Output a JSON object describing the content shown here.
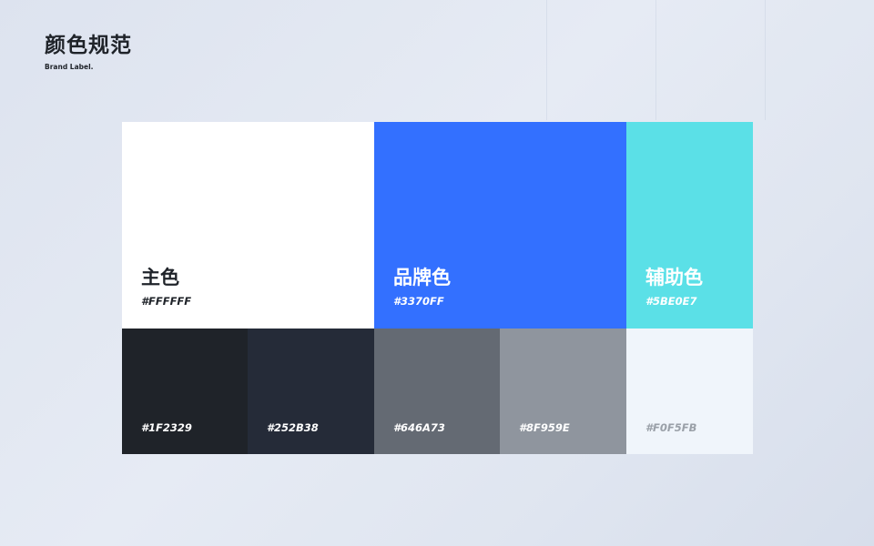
{
  "header": {
    "title": "颜色规范",
    "subtitle": "Brand Label."
  },
  "primary_colors": [
    {
      "name": "主色",
      "code": "#FFFFFF",
      "color": "#FFFFFF",
      "text_color": "#1F2329"
    },
    {
      "name": "品牌色",
      "code": "#3370FF",
      "color": "#3370FF",
      "text_color": "#FFFFFF"
    },
    {
      "name": "辅助色",
      "code": "#5BE0E7",
      "color": "#5BE0E7",
      "text_color": "#FFFFFF"
    }
  ],
  "neutral_colors": [
    {
      "code": "#1F2329",
      "color": "#1F2329",
      "text_color": "#FFFFFF"
    },
    {
      "code": "#252B38",
      "color": "#252B38",
      "text_color": "#FFFFFF"
    },
    {
      "code": "#646A73",
      "color": "#646A73",
      "text_color": "#FFFFFF"
    },
    {
      "code": "#8F959E",
      "color": "#8F959E",
      "text_color": "#FFFFFF"
    },
    {
      "code": "#F0F5FB",
      "color": "#F0F5FB",
      "text_color": "#9AA0A8"
    }
  ]
}
